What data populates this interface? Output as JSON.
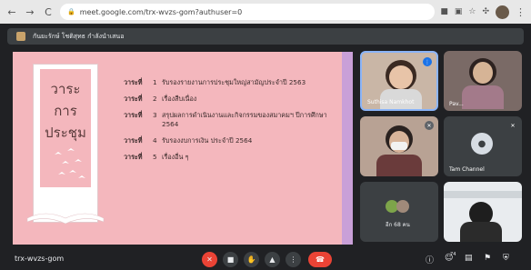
{
  "browser": {
    "back": "←",
    "forward": "→",
    "reload": "C",
    "url": "meet.google.com/trx-wvzs-gom?authuser=0"
  },
  "presenting": {
    "label": "กันยะรักษ์ โชติสุทธ กำลังนำเสนอ"
  },
  "slide": {
    "title_lines": [
      "วาระ",
      "การ",
      "ประชุม"
    ],
    "agenda": [
      {
        "key": "วาระที่",
        "num": "1",
        "text": "รับรองรายงานการประชุมใหญ่สามัญประจำปี 2563"
      },
      {
        "key": "วาระที่",
        "num": "2",
        "text": "เรื่องสืบเนื่อง"
      },
      {
        "key": "วาระที่",
        "num": "3",
        "text": "สรุปผลการดำเนินงานและกิจกรรมของสมาคมฯ ปีการศึกษา 2564"
      },
      {
        "key": "วาระที่",
        "num": "4",
        "text": "รับรองงบการเงิน ประจำปี 2564"
      },
      {
        "key": "วาระที่",
        "num": "5",
        "text": "เรื่องอื่น ๆ"
      }
    ]
  },
  "participants": [
    {
      "name": "Suthisa Namkhot",
      "state": "speaking"
    },
    {
      "name": "Pav...",
      "state": "video"
    },
    {
      "name": "",
      "state": "muted"
    },
    {
      "name": "Tam Channel",
      "state": "muted"
    },
    {
      "name": "อีก 68 คน",
      "state": "group"
    },
    {
      "name": "",
      "state": "video"
    }
  ],
  "bottom": {
    "meeting_code": "trx-wvzs-gom",
    "participants_count": "74"
  },
  "colors": {
    "slide_bg": "#f4b7bd",
    "accent_red": "#ea4335",
    "active_border": "#8ab4f8"
  }
}
